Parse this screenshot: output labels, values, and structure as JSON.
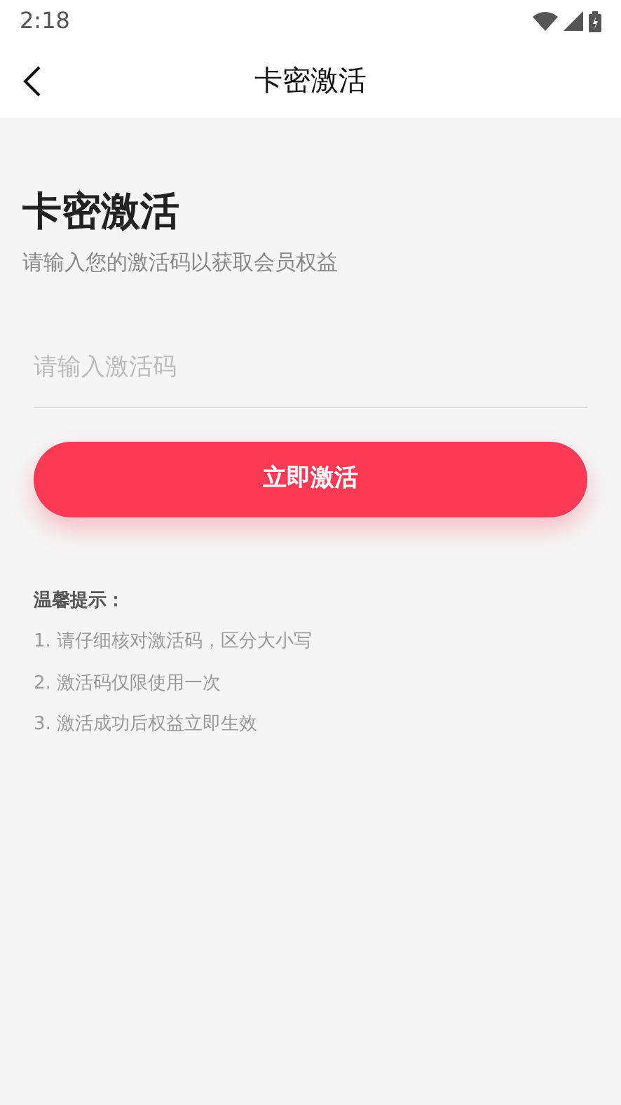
{
  "status_bar": {
    "time": "2:18"
  },
  "header": {
    "title": "卡密激活"
  },
  "heading": "卡密激活",
  "subtitle": "请输入您的激活码以获取会员权益",
  "code_field": {
    "placeholder": "请输入激活码"
  },
  "activate_button": "立即激活",
  "tips": {
    "title": "温馨提示：",
    "items": [
      "1. 请仔细核对激活码，区分大小写",
      "2. 激活码仅限使用一次",
      "3. 激活成功后权益立即生效"
    ]
  }
}
